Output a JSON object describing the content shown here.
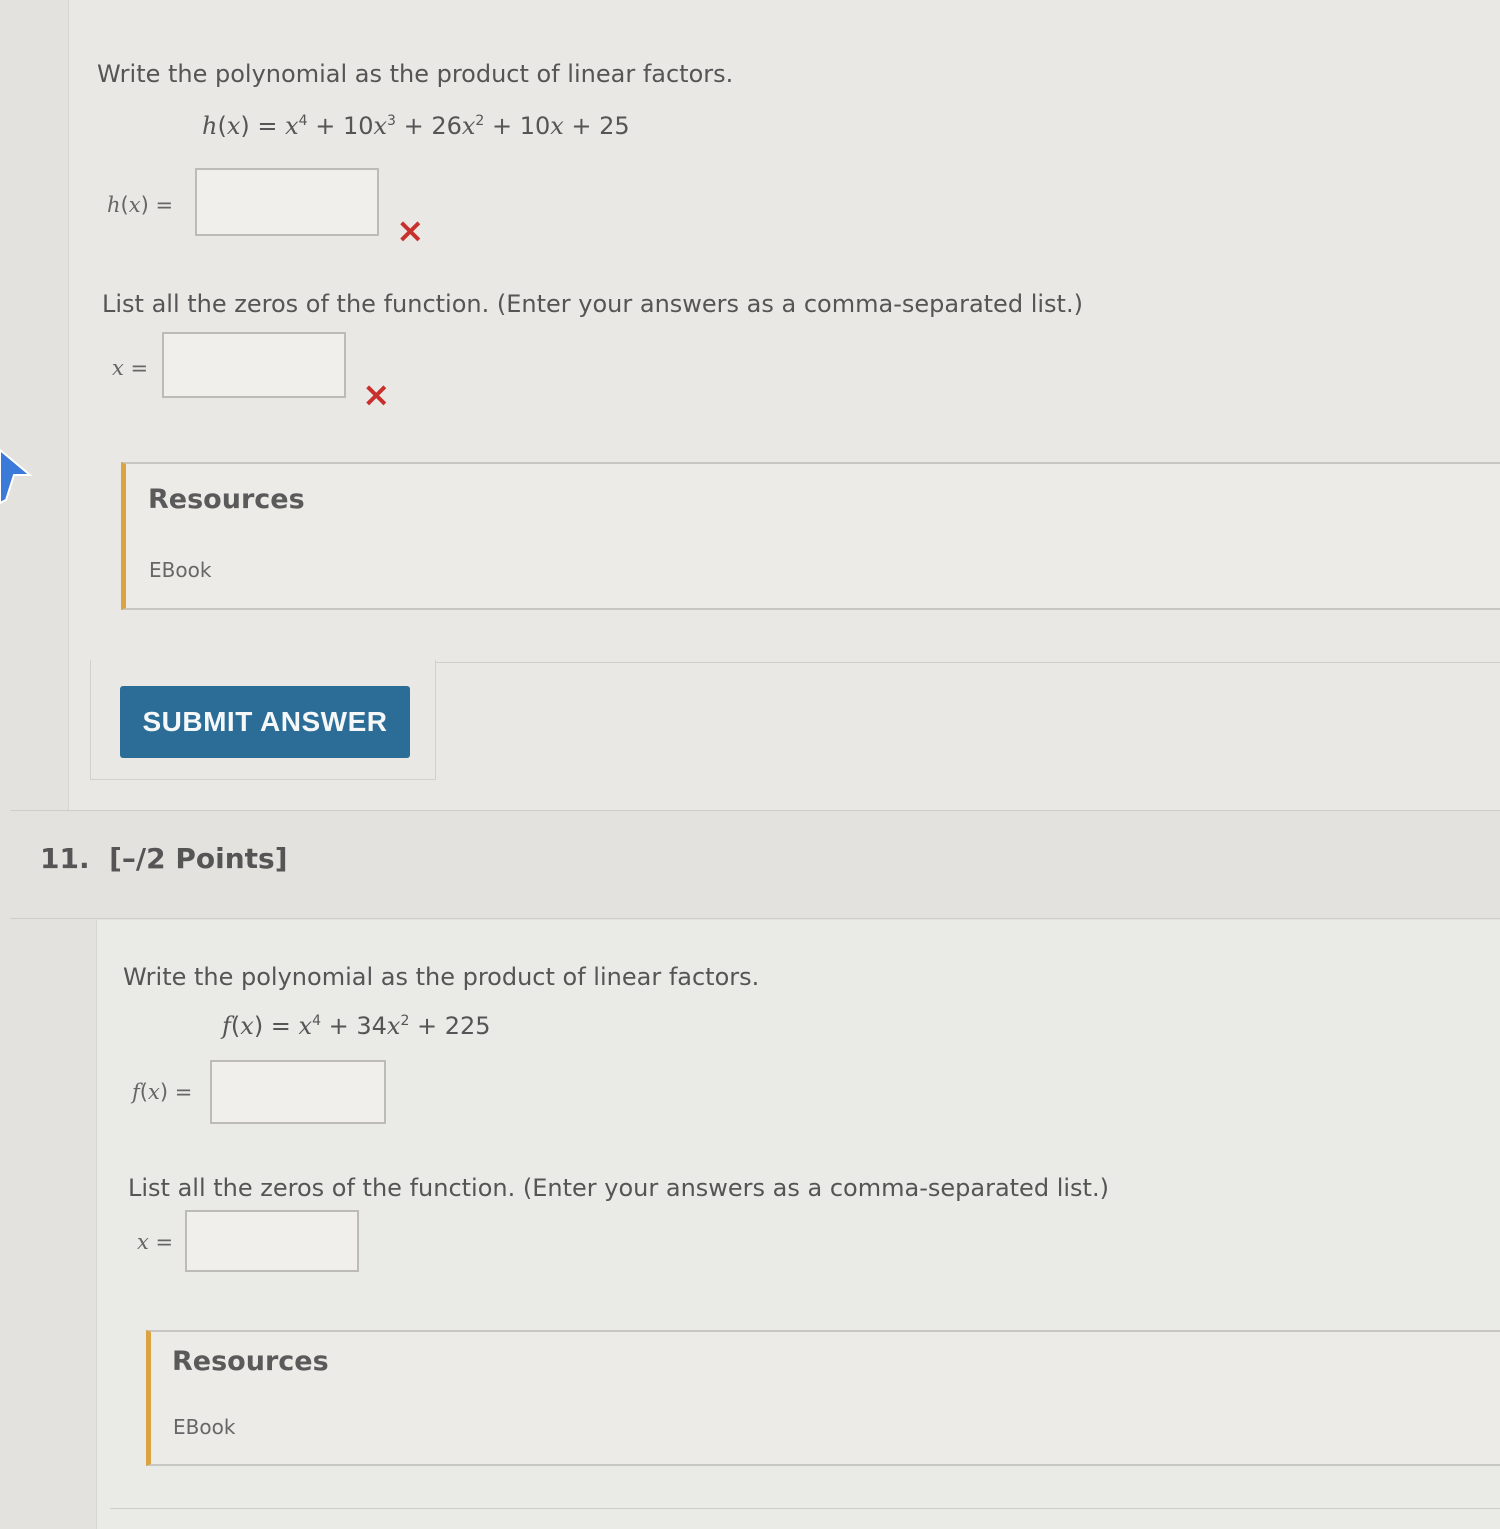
{
  "q10": {
    "prompt": "Write the polynomial as the product of linear factors.",
    "function_name": "h",
    "answer_label_fn": "h",
    "factors_value": "",
    "factors_feedback": "×",
    "zeros_prompt": "List all the zeros of the function. (Enter your answers as a comma-separated list.)",
    "zeros_label": "x",
    "zeros_value": "",
    "zeros_feedback": "×",
    "resources_title": "Resources",
    "resources_link": "EBook",
    "submit_label": "SUBMIT ANSWER"
  },
  "q11": {
    "number": "11.",
    "points": "[–/2 Points]",
    "prompt": "Write the polynomial as the product of linear factors.",
    "function_name": "f",
    "answer_label_fn": "f",
    "factors_value": "",
    "zeros_prompt": "List all the zeros of the function. (Enter your answers as a comma-separated list.)",
    "zeros_label": "x",
    "zeros_value": "",
    "resources_title": "Resources",
    "resources_link": "EBook"
  },
  "colors": {
    "submit_button": "#2b6d96",
    "incorrect_mark": "#c9302c",
    "resources_accent": "#d9a441"
  },
  "icons": {
    "incorrect": "x-mark-icon",
    "cursor": "mouse-pointer-icon"
  }
}
